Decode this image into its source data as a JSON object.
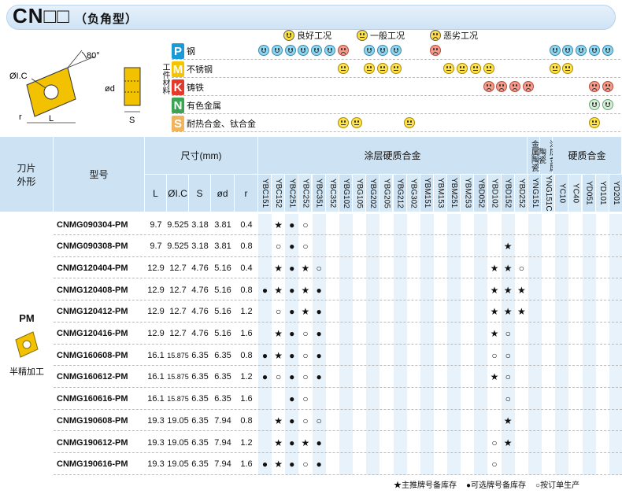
{
  "header": {
    "title": "CN□□",
    "subtitle": "（负角型）"
  },
  "legend": [
    {
      "icon": "good-face-icon",
      "label": "良好工况"
    },
    {
      "icon": "normal-face-icon",
      "label": "一般工况"
    },
    {
      "icon": "bad-face-icon",
      "label": "恶劣工况"
    }
  ],
  "diagram": {
    "angle": "80°",
    "ic": "ØI.C",
    "r": "r",
    "L": "L",
    "od": "ød",
    "S": "S"
  },
  "materials_side_label": "工件材料",
  "materials": [
    {
      "letter": "P",
      "color": "#1a9ad6",
      "name": "钢"
    },
    {
      "letter": "M",
      "color": "#f5c400",
      "name": "不锈钢"
    },
    {
      "letter": "K",
      "color": "#e43a2c",
      "name": "铸铁"
    },
    {
      "letter": "N",
      "color": "#3aa453",
      "name": "有色金属"
    },
    {
      "letter": "S",
      "color": "#f0b55c",
      "name": "耐热合金、钛合金"
    }
  ],
  "table_headers": {
    "shape": "刀片外形",
    "model": "型号",
    "dims": "尺寸(mm)",
    "dim_cols": [
      "L",
      "ØI.C",
      "S",
      "ød",
      "r"
    ],
    "coated": "涂层硬质合金",
    "cermet": "金属陶瓷",
    "coated_cermet": "涂层金属陶瓷",
    "carbide": "硬质合金"
  },
  "grades": [
    "YBC151",
    "YBC152",
    "YBC251",
    "YBC252",
    "YBC351",
    "YBC352",
    "YBG102",
    "YBG105",
    "YBG202",
    "YBG205",
    "YBG212",
    "YBG302",
    "YBM151",
    "YBM153",
    "YBM251",
    "YBM253",
    "YBD052",
    "YBD102",
    "YBD152",
    "YBD252",
    "YNG151",
    "YNG151C",
    "YC10",
    "YC40",
    "YD051",
    "YD101",
    "YD201"
  ],
  "group": {
    "name": "PM",
    "desc": "半精加工"
  },
  "rows": [
    {
      "model": "CNMG090304-PM",
      "L": "9.7",
      "IC": "9.525",
      "S": "3.18",
      "d": "3.81",
      "r": "0.4",
      "marks": [
        "",
        "★",
        "●",
        "○",
        "",
        "",
        "",
        "",
        "",
        "",
        "",
        "",
        "",
        "",
        "",
        "",
        "",
        "",
        "",
        "",
        "",
        "",
        "",
        "",
        "",
        "",
        ""
      ]
    },
    {
      "model": "CNMG090308-PM",
      "L": "9.7",
      "IC": "9.525",
      "S": "3.18",
      "d": "3.81",
      "r": "0.8",
      "marks": [
        "",
        "○",
        "●",
        "○",
        "",
        "",
        "",
        "",
        "",
        "",
        "",
        "",
        "",
        "",
        "",
        "",
        "",
        "",
        "★",
        "",
        "",
        "",
        "",
        "",
        "",
        "",
        ""
      ]
    },
    {
      "model": "CNMG120404-PM",
      "L": "12.9",
      "IC": "12.7",
      "S": "4.76",
      "d": "5.16",
      "r": "0.4",
      "marks": [
        "",
        "★",
        "●",
        "★",
        "○",
        "",
        "",
        "",
        "",
        "",
        "",
        "",
        "",
        "",
        "",
        "",
        "",
        "★",
        "★",
        "○",
        "",
        "",
        "",
        "",
        "",
        "",
        ""
      ]
    },
    {
      "model": "CNMG120408-PM",
      "L": "12.9",
      "IC": "12.7",
      "S": "4.76",
      "d": "5.16",
      "r": "0.8",
      "marks": [
        "●",
        "★",
        "●",
        "★",
        "●",
        "",
        "",
        "",
        "",
        "",
        "",
        "",
        "",
        "",
        "",
        "",
        "",
        "★",
        "★",
        "★",
        "",
        "",
        "",
        "",
        "",
        "",
        ""
      ]
    },
    {
      "model": "CNMG120412-PM",
      "L": "12.9",
      "IC": "12.7",
      "S": "4.76",
      "d": "5.16",
      "r": "1.2",
      "marks": [
        "",
        "○",
        "●",
        "★",
        "●",
        "",
        "",
        "",
        "",
        "",
        "",
        "",
        "",
        "",
        "",
        "",
        "",
        "★",
        "★",
        "★",
        "",
        "",
        "",
        "",
        "",
        "",
        ""
      ]
    },
    {
      "model": "CNMG120416-PM",
      "L": "12.9",
      "IC": "12.7",
      "S": "4.76",
      "d": "5.16",
      "r": "1.6",
      "marks": [
        "",
        "★",
        "●",
        "○",
        "●",
        "",
        "",
        "",
        "",
        "",
        "",
        "",
        "",
        "",
        "",
        "",
        "",
        "★",
        "○",
        "",
        "",
        "",
        "",
        "",
        "",
        "",
        ""
      ]
    },
    {
      "model": "CNMG160608-PM",
      "L": "16.1",
      "IC": "15.875",
      "S": "6.35",
      "d": "6.35",
      "r": "0.8",
      "marks": [
        "●",
        "★",
        "●",
        "○",
        "●",
        "",
        "",
        "",
        "",
        "",
        "",
        "",
        "",
        "",
        "",
        "",
        "",
        "○",
        "○",
        "",
        "",
        "",
        "",
        "",
        "",
        "",
        ""
      ]
    },
    {
      "model": "CNMG160612-PM",
      "L": "16.1",
      "IC": "15.875",
      "S": "6.35",
      "d": "6.35",
      "r": "1.2",
      "marks": [
        "●",
        "○",
        "●",
        "○",
        "●",
        "",
        "",
        "",
        "",
        "",
        "",
        "",
        "",
        "",
        "",
        "",
        "",
        "★",
        "○",
        "",
        "",
        "",
        "",
        "",
        "",
        "",
        ""
      ]
    },
    {
      "model": "CNMG160616-PM",
      "L": "16.1",
      "IC": "15.875",
      "S": "6.35",
      "d": "6.35",
      "r": "1.6",
      "marks": [
        "",
        "",
        "●",
        "○",
        "",
        "",
        "",
        "",
        "",
        "",
        "",
        "",
        "",
        "",
        "",
        "",
        "",
        "",
        "○",
        "",
        "",
        "",
        "",
        "",
        "",
        "",
        ""
      ]
    },
    {
      "model": "CNMG190608-PM",
      "L": "19.3",
      "IC": "19.05",
      "S": "6.35",
      "d": "7.94",
      "r": "0.8",
      "marks": [
        "",
        "★",
        "●",
        "○",
        "○",
        "",
        "",
        "",
        "",
        "",
        "",
        "",
        "",
        "",
        "",
        "",
        "",
        "",
        "★",
        "",
        "",
        "",
        "",
        "",
        "",
        "",
        ""
      ]
    },
    {
      "model": "CNMG190612-PM",
      "L": "19.3",
      "IC": "19.05",
      "S": "6.35",
      "d": "7.94",
      "r": "1.2",
      "marks": [
        "",
        "★",
        "●",
        "★",
        "●",
        "",
        "",
        "",
        "",
        "",
        "",
        "",
        "",
        "",
        "",
        "",
        "",
        "○",
        "★",
        "",
        "",
        "",
        "",
        "",
        "",
        "",
        ""
      ]
    },
    {
      "model": "CNMG190616-PM",
      "L": "19.3",
      "IC": "19.05",
      "S": "6.35",
      "d": "7.94",
      "r": "1.6",
      "marks": [
        "●",
        "★",
        "●",
        "○",
        "●",
        "",
        "",
        "",
        "",
        "",
        "",
        "",
        "",
        "",
        "",
        "",
        "",
        "○",
        "",
        "",
        "",
        "",
        "",
        "",
        "",
        "",
        ""
      ]
    }
  ],
  "footer": [
    "★主推牌号备库存",
    "●可选牌号备库存",
    "○按订单生产"
  ]
}
